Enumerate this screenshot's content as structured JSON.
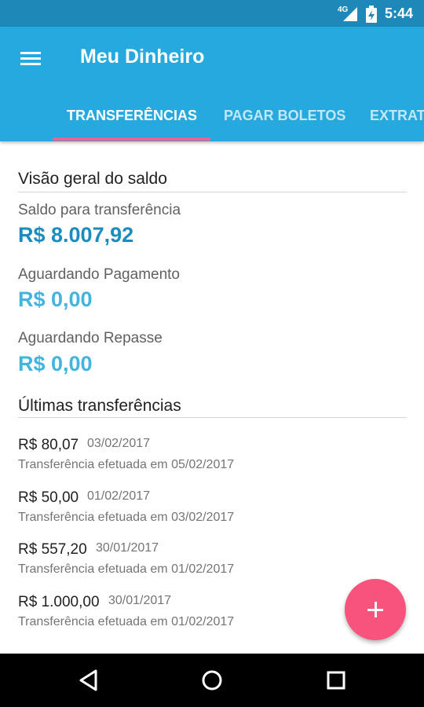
{
  "status_bar": {
    "network": "4G",
    "time": "5:44"
  },
  "app_bar": {
    "title": "Meu Dinheiro",
    "menu_icon": "hamburger-menu-icon"
  },
  "tabs": [
    {
      "label": "TRANSFERÊNCIAS",
      "active": true
    },
    {
      "label": "PAGAR BOLETOS",
      "active": false
    },
    {
      "label": "EXTRATO",
      "active": false
    }
  ],
  "colors": {
    "primary": "#25a9df",
    "primary_dark": "#1e88b8",
    "accent": "#f7537d",
    "tab_indicator": "#f06292",
    "amount_main": "#1c8cbf",
    "amount_light": "#44b4df"
  },
  "overview": {
    "title": "Visão geral do saldo",
    "available_label": "Saldo para transferência",
    "available_amount": "R$ 8.007,92",
    "pending_payment_label": "Aguardando Pagamento",
    "pending_payment_amount": "R$ 0,00",
    "pending_transfer_label": "Aguardando Repasse",
    "pending_transfer_amount": "R$ 0,00"
  },
  "transfers": {
    "title": "Últimas transferências",
    "items": [
      {
        "value": "R$ 80,07",
        "date": "03/02/2017",
        "description": "Transferência efetuada em 05/02/2017"
      },
      {
        "value": "R$ 50,00",
        "date": "01/02/2017",
        "description": "Transferência efetuada em 03/02/2017"
      },
      {
        "value": "R$ 557,20",
        "date": "30/01/2017",
        "description": "Transferência efetuada em 01/02/2017"
      },
      {
        "value": "R$ 1.000,00",
        "date": "30/01/2017",
        "description": "Transferência efetuada em 01/02/2017"
      }
    ]
  },
  "fab": {
    "icon": "plus-icon"
  },
  "nav_bar": {
    "back_icon": "back-triangle-icon",
    "home_icon": "home-circle-icon",
    "recents_icon": "recents-square-icon"
  }
}
